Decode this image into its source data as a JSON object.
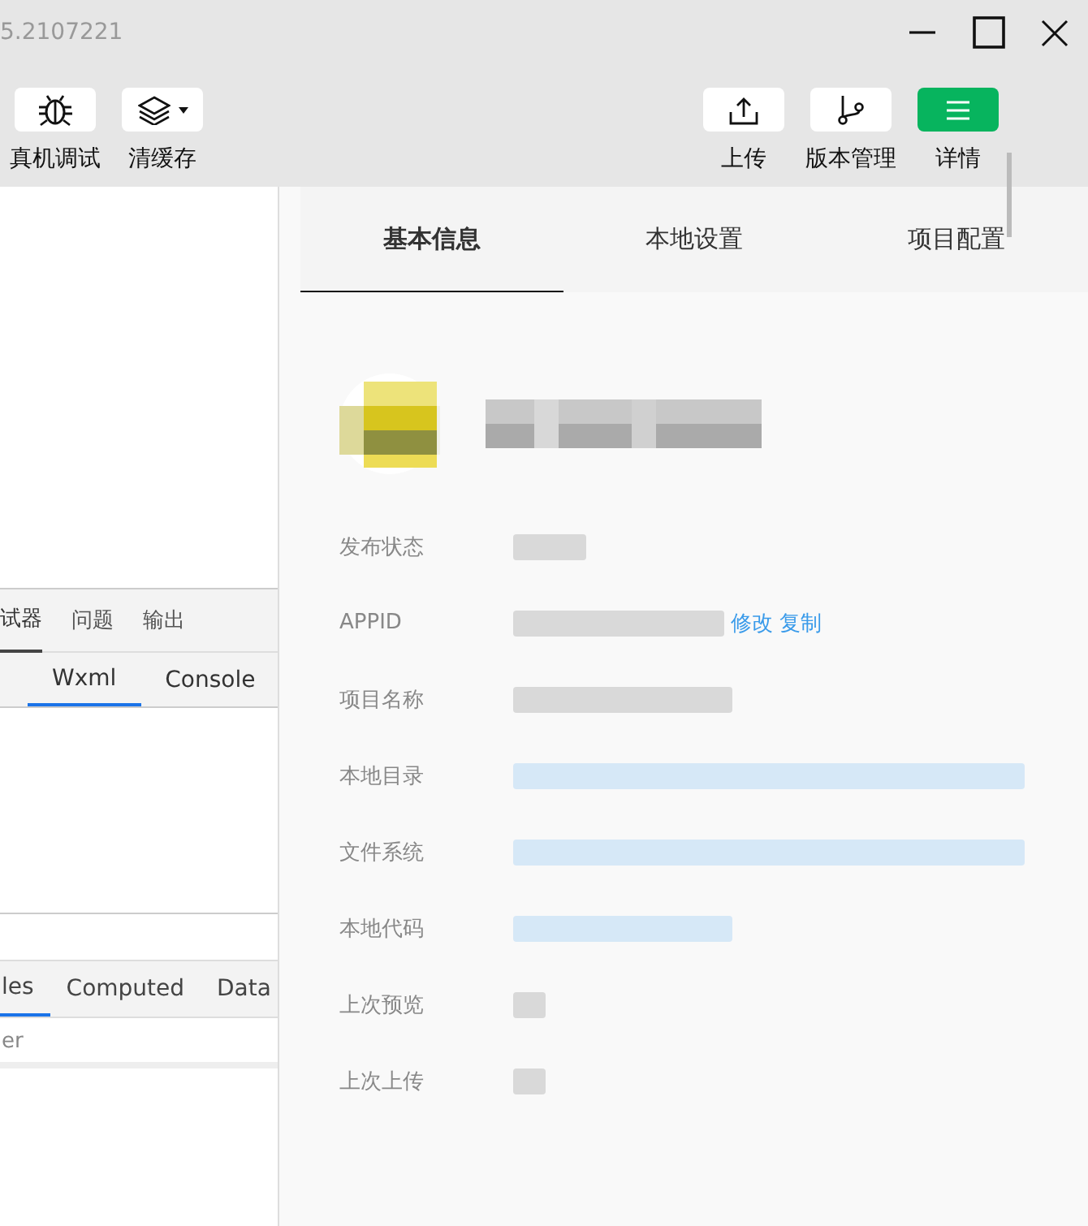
{
  "window": {
    "title": "5.2107221"
  },
  "toolbar": {
    "left": [
      {
        "label": "真机调试",
        "kind": "plain"
      },
      {
        "label": "清缓存",
        "kind": "dropdown"
      }
    ],
    "right": [
      {
        "label": "上传",
        "kind": "plain"
      },
      {
        "label": "版本管理",
        "kind": "plain"
      },
      {
        "label": "详情",
        "kind": "primary"
      }
    ]
  },
  "debugger": {
    "tabs": [
      {
        "label": "试器",
        "selected": true
      },
      {
        "label": "问题",
        "selected": false
      },
      {
        "label": "输出",
        "selected": false
      }
    ],
    "panel_tabs": [
      {
        "label": "Wxml",
        "selected": true
      },
      {
        "label": "Console",
        "selected": false
      }
    ],
    "style_tabs": [
      {
        "label": "les",
        "selected": true
      },
      {
        "label": "Computed",
        "selected": false
      },
      {
        "label": "Data",
        "selected": false
      }
    ],
    "filter": {
      "placeholder": "er"
    }
  },
  "details": {
    "tabs": [
      {
        "label": "基本信息",
        "selected": true
      },
      {
        "label": "本地设置",
        "selected": false
      },
      {
        "label": "项目配置",
        "selected": false
      }
    ],
    "rows": [
      {
        "label": "发布状态",
        "redacted": true
      },
      {
        "label": "APPID",
        "redacted": true,
        "actions": [
          "修改",
          "复制"
        ]
      },
      {
        "label": "项目名称",
        "redacted": true
      },
      {
        "label": "本地目录",
        "redacted": true
      },
      {
        "label": "文件系统",
        "redacted": true
      },
      {
        "label": "本地代码",
        "redacted": true
      },
      {
        "label": "上次预览",
        "redacted": true
      },
      {
        "label": "上次上传",
        "redacted": true
      }
    ]
  }
}
